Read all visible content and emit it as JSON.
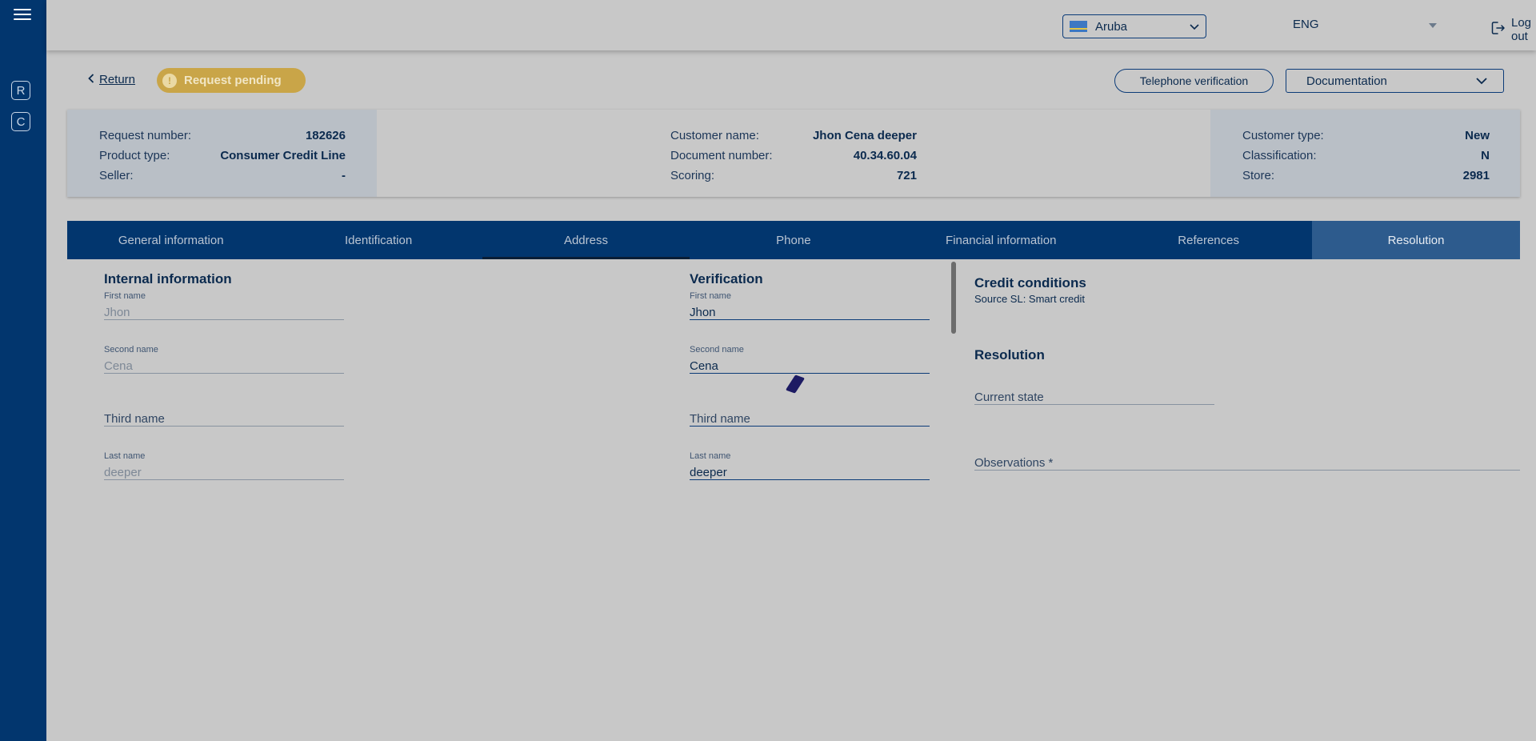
{
  "sidebar": {
    "buttons": [
      "R",
      "C"
    ]
  },
  "topbar": {
    "country": "Aruba",
    "language": "ENG",
    "logout": "Log out"
  },
  "actions": {
    "return": "Return",
    "status": "Request pending",
    "telephone_verification": "Telephone verification",
    "documentation": "Documentation"
  },
  "summary": {
    "left": [
      {
        "label": "Request number:",
        "value": "182626"
      },
      {
        "label": "Product type:",
        "value": "Consumer Credit Line"
      },
      {
        "label": "Seller:",
        "value": "-"
      }
    ],
    "middle": [
      {
        "label": "Customer name:",
        "value": "Jhon Cena deeper"
      },
      {
        "label": "Document number:",
        "value": "40.34.60.04"
      },
      {
        "label": "Scoring:",
        "value": "721"
      }
    ],
    "right": [
      {
        "label": "Customer type:",
        "value": "New"
      },
      {
        "label": "Classification:",
        "value": "N"
      },
      {
        "label": "Store:",
        "value": "2981"
      }
    ]
  },
  "tabs": [
    "General information",
    "Identification",
    "Address",
    "Phone",
    "Financial information",
    "References",
    "Resolution"
  ],
  "internal": {
    "title": "Internal information",
    "first_name_label": "First name",
    "first_name": "Jhon",
    "second_name_label": "Second name",
    "second_name": "Cena",
    "third_name_placeholder": "Third name",
    "last_name_label": "Last name",
    "last_name": "deeper"
  },
  "verification": {
    "title": "Verification",
    "first_name_label": "First name",
    "first_name": "Jhon",
    "second_name_label": "Second name",
    "second_name": "Cena",
    "third_name_placeholder": "Third name",
    "last_name_label": "Last name",
    "last_name": "deeper"
  },
  "credit": {
    "title": "Credit conditions",
    "source": "Source SL: Smart credit"
  },
  "resolution": {
    "title": "Resolution",
    "current_state_placeholder": "Current state",
    "observations_placeholder": "Observations *"
  }
}
